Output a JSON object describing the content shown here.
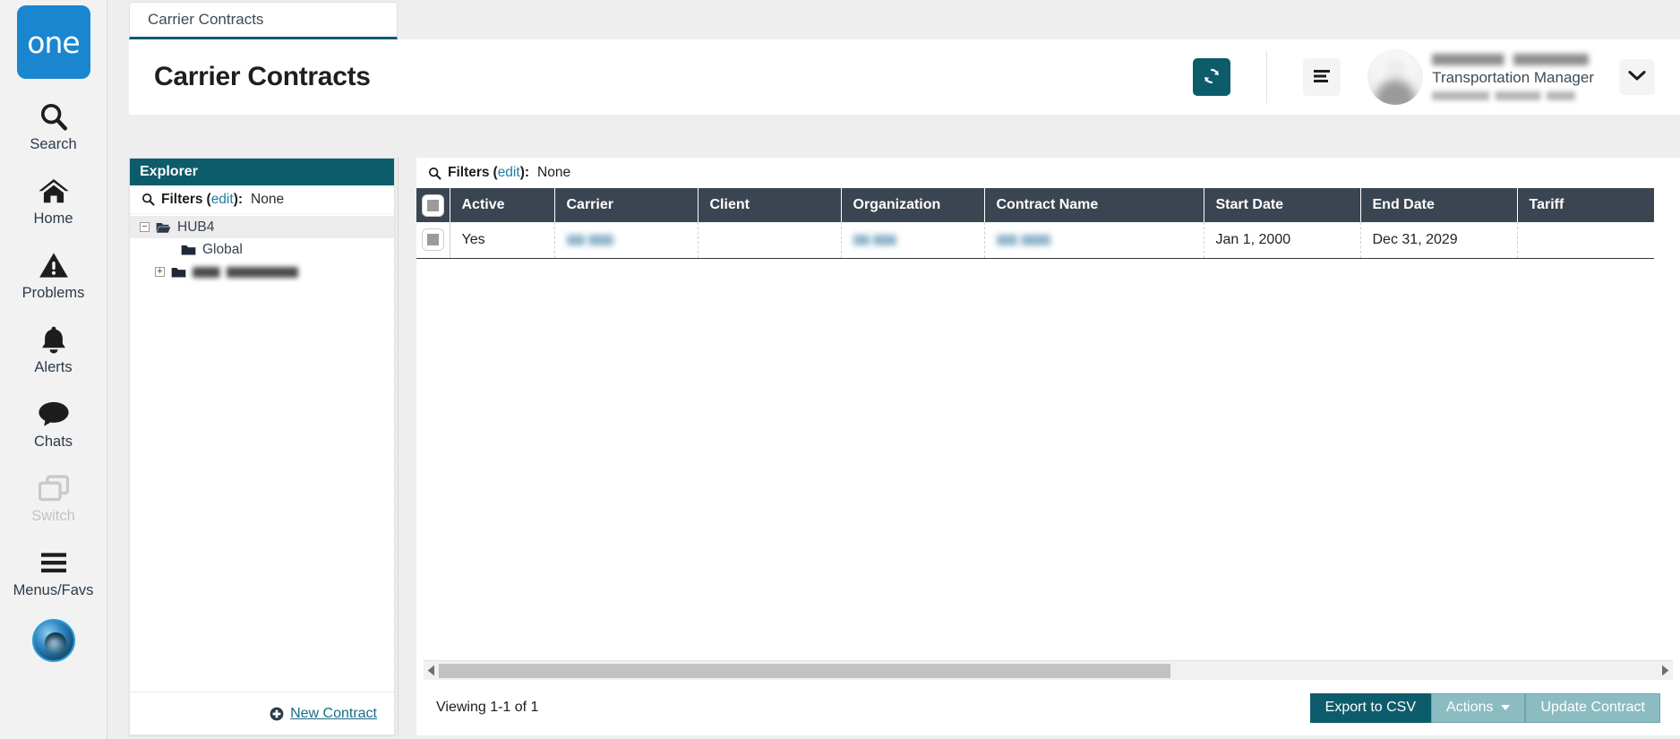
{
  "brand": {
    "wordmark": "one"
  },
  "sidebar": {
    "items": [
      {
        "label": "Search",
        "icon": "search-icon",
        "disabled": false
      },
      {
        "label": "Home",
        "icon": "home-icon",
        "disabled": false
      },
      {
        "label": "Problems",
        "icon": "warning-triangle-icon",
        "disabled": false
      },
      {
        "label": "Alerts",
        "icon": "bell-icon",
        "disabled": false
      },
      {
        "label": "Chats",
        "icon": "chat-bubble-icon",
        "disabled": false
      },
      {
        "label": "Switch",
        "icon": "switch-windows-icon",
        "disabled": true
      },
      {
        "label": "Menus/Favs",
        "icon": "hamburger-icon",
        "disabled": false
      }
    ],
    "avatar_name": "user-avatar"
  },
  "tab": {
    "label": "Carrier Contracts"
  },
  "header": {
    "title": "Carrier Contracts",
    "refresh_icon": "refresh-icon",
    "menu_icon": "list-menu-icon",
    "caret_icon": "chevron-down-icon",
    "user": {
      "name": "",
      "role": "Transportation Manager",
      "sub": ""
    }
  },
  "explorer": {
    "title": "Explorer",
    "filters": {
      "icon": "search-icon",
      "label": "Filters",
      "edit_label": "edit",
      "colon": ":",
      "open_paren": "(",
      "close_paren": ")",
      "value": "None"
    },
    "tree": [
      {
        "label": "HUB4",
        "expander": "minus",
        "depth": 0,
        "selected": true,
        "redacted": false,
        "folder": "folder-open-icon"
      },
      {
        "label": "Global",
        "expander": "none",
        "depth": 1,
        "selected": false,
        "redacted": false,
        "folder": "folder-icon"
      },
      {
        "label": "",
        "expander": "plus",
        "depth": 1,
        "selected": false,
        "redacted": true,
        "folder": "folder-icon"
      }
    ],
    "footer": {
      "new_contract_label": "New Contract",
      "plus_icon": "plus-circle-icon"
    }
  },
  "grid": {
    "filters": {
      "icon": "search-icon",
      "label": "Filters",
      "edit_label": "edit",
      "colon": ":",
      "open_paren": "(",
      "close_paren": ")",
      "value": "None"
    },
    "columns": [
      "Active",
      "Carrier",
      "Client",
      "Organization",
      "Contract Name",
      "Start Date",
      "End Date",
      "Tariff"
    ],
    "rows": [
      {
        "checked": false,
        "Active": "Yes",
        "Carrier": "",
        "Client": "",
        "Organization": "",
        "Contract Name": "",
        "Start Date": "Jan 1, 2000",
        "End Date": "Dec 31, 2029",
        "Tariff": ""
      }
    ],
    "redacted_columns": [
      "Carrier",
      "Organization",
      "Contract Name"
    ],
    "scrollbar": {
      "thumb_percent": 60,
      "left_arrow": "triangle-left-icon",
      "right_arrow": "triangle-right-icon"
    },
    "footer": {
      "viewing": "Viewing 1-1 of 1",
      "buttons": [
        {
          "label": "Export to CSV",
          "style": "primary",
          "caret": false
        },
        {
          "label": "Actions",
          "style": "secondary",
          "caret": true
        },
        {
          "label": "Update Contract",
          "style": "secondary",
          "caret": false
        }
      ]
    }
  },
  "colors": {
    "brand_blue": "#1a86d0",
    "teal": "#0d5c6b",
    "teal_light": "#8bbcc2",
    "header_row": "#3b4552",
    "link": "#1a7ea8",
    "page_bg": "#eeeeee"
  }
}
